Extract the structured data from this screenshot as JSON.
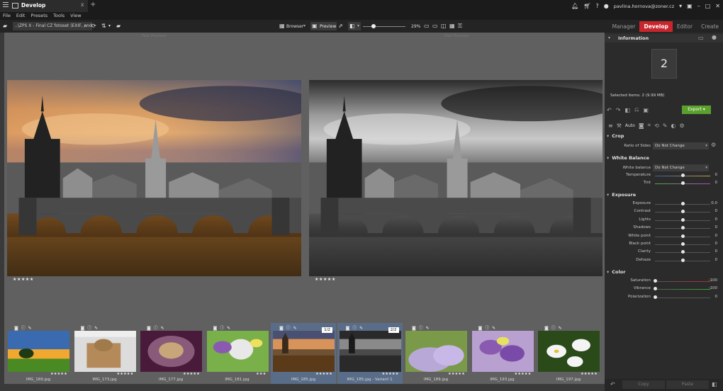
{
  "titlebar": {
    "tab_label": "Develop",
    "new_tab": "+",
    "close": "x",
    "user_email": "pavlina.hornova@zoner.cz",
    "icons": [
      "bell-icon",
      "cart-icon",
      "question-icon",
      "user-icon",
      "window-icon",
      "minimize-icon",
      "maximize-icon",
      "close-icon"
    ]
  },
  "menu": [
    "File",
    "Edit",
    "Presets",
    "Tools",
    "View"
  ],
  "toolbar": {
    "path": "..\\ZPS X - Final CZ fotoset (EXIF, ondr",
    "browser_label": "Browser",
    "preview_label": "Preview",
    "zoom": "29%"
  },
  "modes": [
    {
      "label": "Manager",
      "active": false
    },
    {
      "label": "Develop",
      "active": true
    },
    {
      "label": "Editor",
      "active": false
    },
    {
      "label": "Create",
      "active": false
    }
  ],
  "preview": {
    "left_caption": "Fast Preview",
    "right_caption": "Fast Preview",
    "left_stars": "★★★★★",
    "right_stars": "★★★★★"
  },
  "filmstrip": [
    {
      "name": "IMG_169.jpg",
      "stars": "★★★★★",
      "selected": false,
      "badge": "",
      "kind": "sunset"
    },
    {
      "name": "IMG_173.jpg",
      "stars": "★★★★★",
      "selected": false,
      "badge": "",
      "kind": "cat"
    },
    {
      "name": "IMG_177.jpg",
      "stars": "★★★★★",
      "selected": false,
      "badge": "",
      "kind": "kitten"
    },
    {
      "name": "IMG_181.jpg",
      "stars": "★★★",
      "selected": false,
      "badge": "",
      "kind": "eggs"
    },
    {
      "name": "IMG_185.jpg",
      "stars": "★★★★★",
      "selected": true,
      "badge": "1/2",
      "kind": "bridge"
    },
    {
      "name": "IMG_185.jpg - Variant 1",
      "stars": "★★★★★",
      "selected": true,
      "badge": "2/2",
      "kind": "bridgebw"
    },
    {
      "name": "IMG_189.jpg",
      "stars": "★★★★★",
      "selected": false,
      "badge": "",
      "kind": "lavender"
    },
    {
      "name": "IMG_193.jpg",
      "stars": "★★★★★",
      "selected": false,
      "badge": "",
      "kind": "flowers"
    },
    {
      "name": "IMG_197.jpg",
      "stars": "★★★★★",
      "selected": false,
      "badge": "",
      "kind": "daisies"
    }
  ],
  "panel": {
    "information_title": "Information",
    "count": "2",
    "selected_items": "Selected items: 2 (9.99 MB)",
    "export_label": "Export",
    "auto_label": "Auto",
    "crop": {
      "title": "Crop",
      "ratio_label": "Ratio of Sides",
      "ratio_value": "Do Not Change"
    },
    "white_balance": {
      "title": "White Balance",
      "wb_label": "White balance",
      "wb_value": "Do Not Change",
      "sliders": [
        {
          "label": "Temperature",
          "value": "0",
          "level": 0.5
        },
        {
          "label": "Tint",
          "value": "0",
          "level": 0.5
        }
      ]
    },
    "exposure": {
      "title": "Exposure",
      "sliders": [
        {
          "label": "Exposure",
          "value": "0.0",
          "level": 0.5
        },
        {
          "label": "Contrast",
          "value": "0",
          "level": 0.5
        },
        {
          "label": "Lights",
          "value": "0",
          "level": 0.5
        },
        {
          "label": "Shadows",
          "value": "0",
          "level": 0.5
        },
        {
          "label": "White point",
          "value": "0",
          "level": 0.5
        },
        {
          "label": "Black point",
          "value": "0",
          "level": 0.5
        },
        {
          "label": "Clarity",
          "value": "0",
          "level": 0.5
        },
        {
          "label": "Dehaze",
          "value": "0",
          "level": 0.5
        }
      ]
    },
    "color": {
      "title": "Color",
      "sliders": [
        {
          "label": "Saturation",
          "value": "-100",
          "level": 0.0
        },
        {
          "label": "Vibrance",
          "value": "-100",
          "level": 0.0
        },
        {
          "label": "Polarization",
          "value": "0",
          "level": 0.0
        }
      ]
    },
    "bottom": {
      "copy_label": "Copy",
      "paste_label": "Paste"
    }
  },
  "colors": {
    "accent": "#c8262c",
    "export": "#5aa02c",
    "selection": "#5a6d88"
  }
}
